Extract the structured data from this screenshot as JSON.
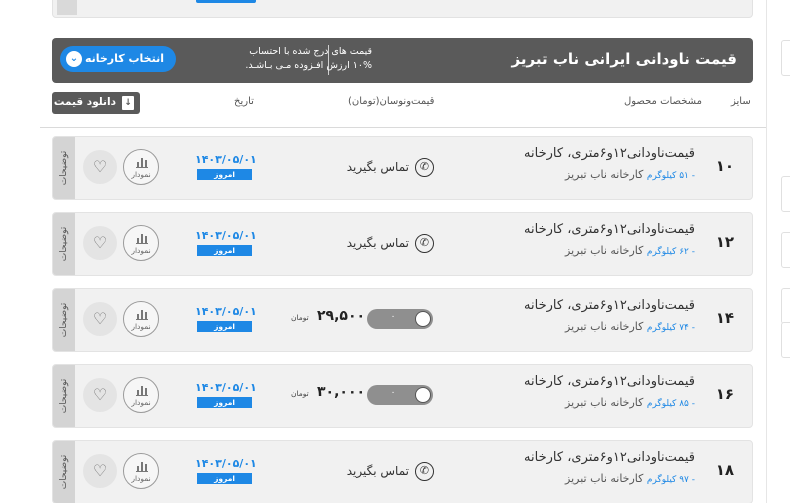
{
  "table": {
    "title": "قیمت ناودانی ایرانی ناب تبریز",
    "vat_note_line1": "قیمت های درج شده با احتساب",
    "vat_note_line2": "۱۰% ارزش افـزوده مـی بـاشـد.",
    "select_factory_label": "انتخاب کارخانه",
    "download_price_label": "دانلود قیمت",
    "columns": {
      "size": "سایز",
      "spec": "مشخصات محصول",
      "price": "قیمت‌ونوسان(تومان)",
      "date": "تاریخ"
    }
  },
  "labels": {
    "description": "توضیحات",
    "chart": "نمودار",
    "today": "امروز",
    "contact": "تماس بگیرید",
    "toman": "تومان"
  },
  "rows": [
    {
      "size": "۱۰",
      "name": "قیمت‌ناودانی۱۲و۶متری، کارخانه",
      "factory": "کارخانه ناب تبریز",
      "weight": "- ۵۱ کیلوگرم",
      "date": "۱۴۰۳/۰۵/۰۱",
      "price": null,
      "change": null
    },
    {
      "size": "۱۲",
      "name": "قیمت‌ناودانی۱۲و۶متری، کارخانه",
      "factory": "کارخانه ناب تبریز",
      "weight": "- ۶۲ کیلوگرم",
      "date": "۱۴۰۳/۰۵/۰۱",
      "price": null,
      "change": null
    },
    {
      "size": "۱۴",
      "name": "قیمت‌ناودانی۱۲و۶متری، کارخانه",
      "factory": "کارخانه ناب تبریز",
      "weight": "- ۷۴ کیلوگرم",
      "date": "۱۴۰۳/۰۵/۰۱",
      "price": "۲۹,۵۰۰",
      "change": "۰"
    },
    {
      "size": "۱۶",
      "name": "قیمت‌ناودانی۱۲و۶متری، کارخانه",
      "factory": "کارخانه ناب تبریز",
      "weight": "- ۸۵ کیلوگرم",
      "date": "۱۴۰۳/۰۵/۰۱",
      "price": "۳۰,۰۰۰",
      "change": "۰"
    },
    {
      "size": "۱۸",
      "name": "قیمت‌ناودانی۱۲و۶متری، کارخانه",
      "factory": "کارخانه ناب تبریز",
      "weight": "- ۹۷ کیلوگرم",
      "date": "۱۴۰۳/۰۵/۰۱",
      "price": null,
      "change": null
    }
  ],
  "icons": {
    "heart": "heart-icon",
    "chart": "bar-chart-icon",
    "phone": "phone-icon",
    "download": "download-icon",
    "chevron": "chevron-down-icon"
  },
  "colors": {
    "accent": "#1e88e5",
    "header_bg": "#5a5a5a",
    "row_bg": "#f1f1f1"
  }
}
